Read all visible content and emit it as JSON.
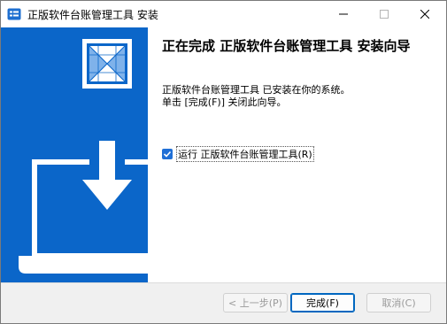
{
  "window": {
    "title": "正版软件台账管理工具 安装"
  },
  "content": {
    "heading": "正在完成 正版软件台账管理工具 安装向导",
    "line1": "正版软件台账管理工具 已安装在你的系统。",
    "line2": "单击 [完成(F)] 关闭此向导。",
    "checkbox_label": "运行 正版软件台账管理工具(R)",
    "checkbox_checked": true
  },
  "footer": {
    "back_label": "< 上一步(P)",
    "finish_label": "完成(F)",
    "cancel_label": "取消(C)"
  },
  "colors": {
    "panel_blue": "#0b66c9",
    "accent": "#0067c0"
  }
}
